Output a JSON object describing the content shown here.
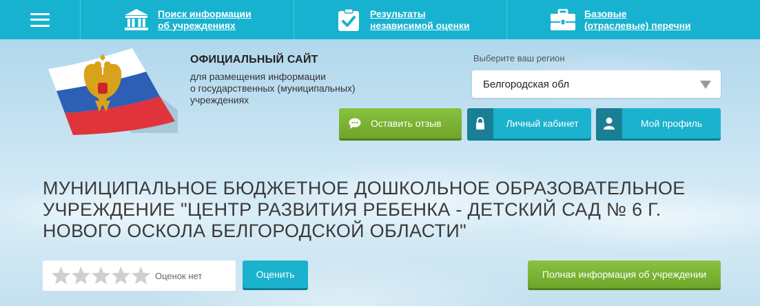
{
  "nav": {
    "items": [
      {
        "label_line1": "Поиск информации",
        "label_line2": "об учреждениях",
        "icon": "institution-building-icon"
      },
      {
        "label_line1": "Результаты",
        "label_line2": "независимой оценки",
        "icon": "clipboard-check-icon"
      },
      {
        "label_line1": "Базовые",
        "label_line2": "(отраслевые) перечни",
        "icon": "briefcase-icon"
      }
    ],
    "menu_icon": "hamburger-menu-icon"
  },
  "site": {
    "title": "ОФИЦИАЛЬНЫЙ САЙТ",
    "description_line1": "для размещения информации",
    "description_line2": "о государственных (муниципальных)",
    "description_line3": "учреждениях",
    "logo_icon": "russian-coat-of-arms-flag-logo"
  },
  "region": {
    "label": "Выберите ваш регион",
    "value": "Белгородская обл"
  },
  "actions": {
    "feedback": "Оставить отзыв",
    "cabinet": "Личный кабинет",
    "profile": "Мой профиль"
  },
  "institution": {
    "name": "МУНИЦИПАЛЬНОЕ БЮДЖЕТНОЕ ДОШКОЛЬНОЕ ОБРАЗОВАТЕЛЬНОЕ УЧРЕЖДЕНИЕ \"ЦЕНТР РАЗВИТИЯ РЕБЕНКА - ДЕТСКИЙ САД № 6 Г. НОВОГО ОСКОЛА БЕЛГОРОДСКОЙ ОБЛАСТИ\""
  },
  "rating": {
    "stars_filled": 0,
    "stars_total": 5,
    "text": "Оценок нет",
    "rate_button": "Оценить"
  },
  "full_info_button": "Полная информация об учреждении",
  "colors": {
    "topbar": "#17b2d0",
    "accent_blue": "#1ab2cd",
    "accent_green": "#7ab535"
  }
}
